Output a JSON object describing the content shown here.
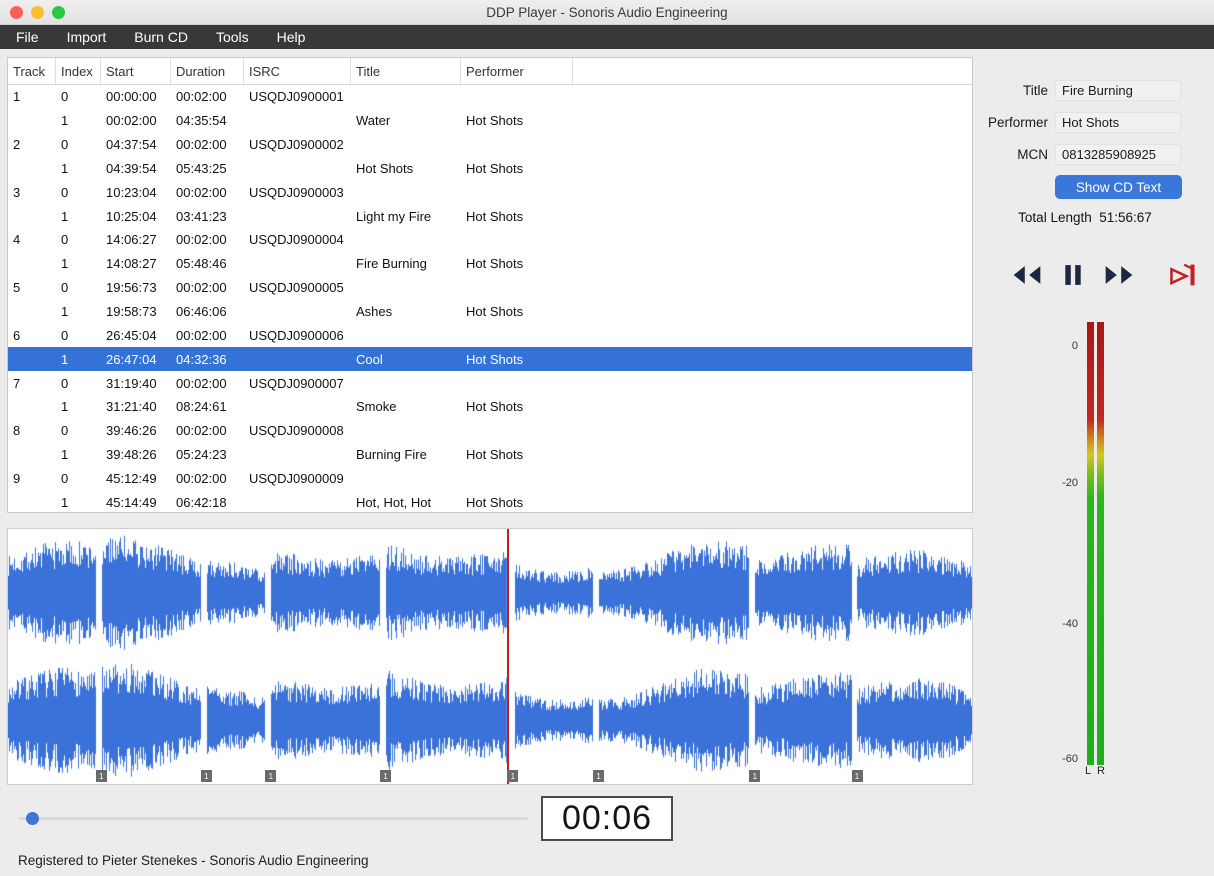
{
  "window_title": "DDP Player - Sonoris Audio Engineering",
  "menu": [
    "File",
    "Import",
    "Burn CD",
    "Tools",
    "Help"
  ],
  "table": {
    "columns": [
      "Track",
      "Index",
      "Start",
      "Duration",
      "ISRC",
      "Title",
      "Performer"
    ],
    "rows": [
      {
        "track": "1",
        "index": "0",
        "start": "00:00:00",
        "duration": "00:02:00",
        "isrc": "USQDJ0900001",
        "title": "",
        "performer": "",
        "selected": false
      },
      {
        "track": "",
        "index": "1",
        "start": "00:02:00",
        "duration": "04:35:54",
        "isrc": "",
        "title": "Water",
        "performer": "Hot Shots",
        "selected": false
      },
      {
        "track": "2",
        "index": "0",
        "start": "04:37:54",
        "duration": "00:02:00",
        "isrc": "USQDJ0900002",
        "title": "",
        "performer": "",
        "selected": false
      },
      {
        "track": "",
        "index": "1",
        "start": "04:39:54",
        "duration": "05:43:25",
        "isrc": "",
        "title": "Hot Shots",
        "performer": "Hot Shots",
        "selected": false
      },
      {
        "track": "3",
        "index": "0",
        "start": "10:23:04",
        "duration": "00:02:00",
        "isrc": "USQDJ0900003",
        "title": "",
        "performer": "",
        "selected": false
      },
      {
        "track": "",
        "index": "1",
        "start": "10:25:04",
        "duration": "03:41:23",
        "isrc": "",
        "title": "Light my Fire",
        "performer": "Hot Shots",
        "selected": false
      },
      {
        "track": "4",
        "index": "0",
        "start": "14:06:27",
        "duration": "00:02:00",
        "isrc": "USQDJ0900004",
        "title": "",
        "performer": "",
        "selected": false
      },
      {
        "track": "",
        "index": "1",
        "start": "14:08:27",
        "duration": "05:48:46",
        "isrc": "",
        "title": "Fire Burning",
        "performer": "Hot Shots",
        "selected": false
      },
      {
        "track": "5",
        "index": "0",
        "start": "19:56:73",
        "duration": "00:02:00",
        "isrc": "USQDJ0900005",
        "title": "",
        "performer": "",
        "selected": false
      },
      {
        "track": "",
        "index": "1",
        "start": "19:58:73",
        "duration": "06:46:06",
        "isrc": "",
        "title": "Ashes",
        "performer": "Hot Shots",
        "selected": false
      },
      {
        "track": "6",
        "index": "0",
        "start": "26:45:04",
        "duration": "00:02:00",
        "isrc": "USQDJ0900006",
        "title": "",
        "performer": "",
        "selected": false
      },
      {
        "track": "",
        "index": "1",
        "start": "26:47:04",
        "duration": "04:32:36",
        "isrc": "",
        "title": "Cool",
        "performer": "Hot Shots",
        "selected": true
      },
      {
        "track": "7",
        "index": "0",
        "start": "31:19:40",
        "duration": "00:02:00",
        "isrc": "USQDJ0900007",
        "title": "",
        "performer": "",
        "selected": false
      },
      {
        "track": "",
        "index": "1",
        "start": "31:21:40",
        "duration": "08:24:61",
        "isrc": "",
        "title": "Smoke",
        "performer": "Hot Shots",
        "selected": false
      },
      {
        "track": "8",
        "index": "0",
        "start": "39:46:26",
        "duration": "00:02:00",
        "isrc": "USQDJ0900008",
        "title": "",
        "performer": "",
        "selected": false
      },
      {
        "track": "",
        "index": "1",
        "start": "39:48:26",
        "duration": "05:24:23",
        "isrc": "",
        "title": "Burning Fire",
        "performer": "Hot Shots",
        "selected": false
      },
      {
        "track": "9",
        "index": "0",
        "start": "45:12:49",
        "duration": "00:02:00",
        "isrc": "USQDJ0900009",
        "title": "",
        "performer": "",
        "selected": false
      },
      {
        "track": "",
        "index": "1",
        "start": "45:14:49",
        "duration": "06:42:18",
        "isrc": "",
        "title": "Hot, Hot, Hot",
        "performer": "Hot Shots",
        "selected": false
      }
    ]
  },
  "side": {
    "fields": [
      {
        "label": "Title",
        "value": "Fire Burning"
      },
      {
        "label": "Performer",
        "value": "Hot Shots"
      },
      {
        "label": "MCN",
        "value": "0813285908925"
      }
    ],
    "show_cd_text_label": "Show CD Text",
    "total_length_label": "Total Length",
    "total_length_value": "51:56:67",
    "transport": [
      "rewind",
      "pause",
      "fast-forward",
      "stop-at-end"
    ],
    "meter": {
      "scale": [
        "0",
        "-20",
        "-40",
        "-60"
      ],
      "channels": [
        "L",
        "R"
      ]
    }
  },
  "waveform": {
    "segments": [
      [
        0.0,
        0.091
      ],
      [
        0.097,
        0.2
      ],
      [
        0.206,
        0.267
      ],
      [
        0.273,
        0.386
      ],
      [
        0.392,
        0.518
      ],
      [
        0.526,
        0.607
      ],
      [
        0.613,
        0.769
      ],
      [
        0.775,
        0.875
      ],
      [
        0.881,
        1.0
      ]
    ],
    "markers": [
      0.091,
      0.2,
      0.267,
      0.386,
      0.518,
      0.607,
      0.769,
      0.875
    ],
    "marker_label": "1",
    "playhead_frac": 0.5176
  },
  "player": {
    "time": "00:06"
  },
  "status_text": "Registered to Pieter Stenekes - Sonoris Audio Engineering",
  "colors": {
    "selection": "#3472d7",
    "accent_button": "#3a77d9",
    "waveform": "#3a72d9",
    "playhead": "#c41f1f",
    "meter_red": "#a81717",
    "meter_yellow": "#cfc81e",
    "meter_green": "#2ab61d",
    "icon_dark": "#1c2742",
    "icon_red": "#c42020"
  }
}
